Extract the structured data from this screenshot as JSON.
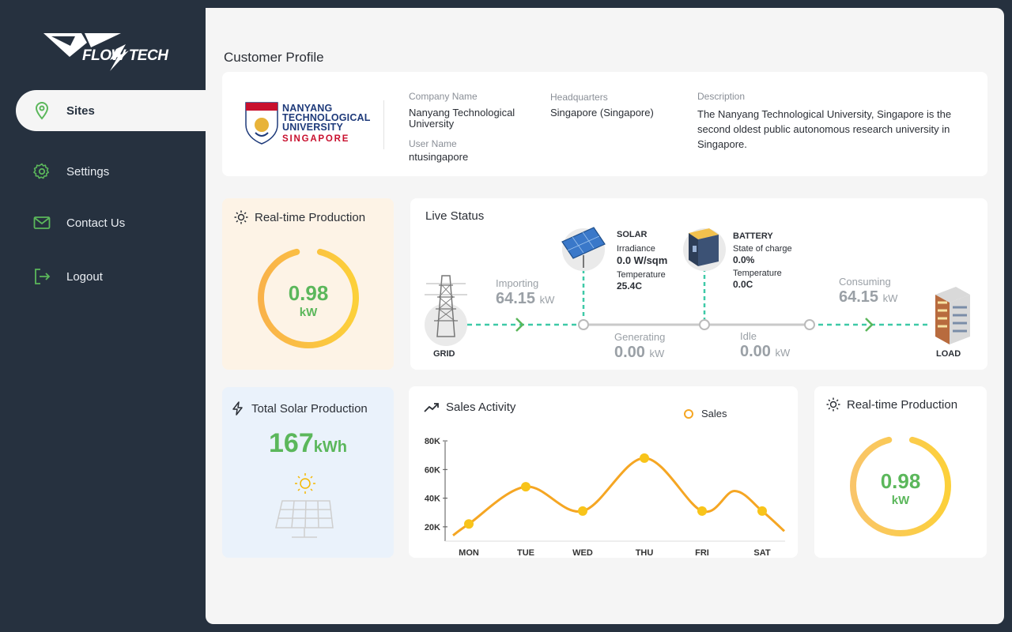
{
  "brand": {
    "logo_text": "FLOW TECH"
  },
  "sidebar": {
    "items": [
      {
        "label": "Sites",
        "icon": "map-pin-icon",
        "active": true
      },
      {
        "label": "Settings",
        "icon": "gear-icon",
        "active": false
      },
      {
        "label": "Contact Us",
        "icon": "mail-icon",
        "active": false
      },
      {
        "label": "Logout",
        "icon": "logout-icon",
        "active": false
      }
    ]
  },
  "profile": {
    "title": "Customer Profile",
    "logo": {
      "line1": "NANYANG",
      "line2": "TECHNOLOGICAL",
      "line3": "UNIVERSITY",
      "sub": "SINGAPORE"
    },
    "company_label": "Company Name",
    "company_value": "Nanyang Technological University",
    "user_label": "User Name",
    "user_value": "ntusingapore",
    "hq_label": "Headquarters",
    "hq_value": "Singapore (Singapore)",
    "desc_label": "Description",
    "desc_value": "The Nanyang Technological University, Singapore is the second oldest public autonomous research university in Singapore."
  },
  "realtime_top": {
    "title": "Real-time Production",
    "value": "0.98",
    "unit": "kW",
    "gauge_fraction": 0.92
  },
  "live_status": {
    "title": "Live Status",
    "grid_label": "GRID",
    "load_label": "LOAD",
    "importing_label": "Importing",
    "importing_value": "64.15",
    "importing_unit": "kW",
    "generating_label": "Generating",
    "generating_value": "0.00",
    "generating_unit": "kW",
    "idle_label": "Idle",
    "idle_value": "0.00",
    "idle_unit": "kW",
    "consuming_label": "Consuming",
    "consuming_value": "64.15",
    "consuming_unit": "kW",
    "solar": {
      "title": "SOLAR",
      "irr_label": "Irradiance",
      "irr_value": "0.0 W/sqm",
      "temp_label": "Temperature",
      "temp_value": "25.4C"
    },
    "battery": {
      "title": "BATTERY",
      "soc_label": "State of charge",
      "soc_value": "0.0%",
      "temp_label": "Temperature",
      "temp_value": "0.0C"
    }
  },
  "total_solar": {
    "title": "Total Solar Production",
    "value": "167",
    "unit": "kWh"
  },
  "sales": {
    "title": "Sales Activity",
    "legend": "Sales",
    "accent": "#f5a623"
  },
  "chart_data": {
    "type": "line",
    "title": "Sales Activity",
    "categories": [
      "MON",
      "TUE",
      "WED",
      "THU",
      "FRI",
      "SAT"
    ],
    "series": [
      {
        "name": "Sales",
        "values": [
          22000,
          48000,
          31000,
          68000,
          31000,
          31000
        ]
      }
    ],
    "yticks": [
      "20K",
      "40K",
      "60K",
      "80K"
    ],
    "ylim": [
      10000,
      85000
    ],
    "legend_position": "top-right",
    "grid": false
  },
  "realtime_bottom": {
    "title": "Real-time Production",
    "value": "0.98",
    "unit": "kW",
    "gauge_fraction": 0.92
  },
  "colors": {
    "sidebar": "#26313f",
    "green": "#5bb75b",
    "orange": "#f5a623",
    "teal": "#3ec9a7"
  }
}
